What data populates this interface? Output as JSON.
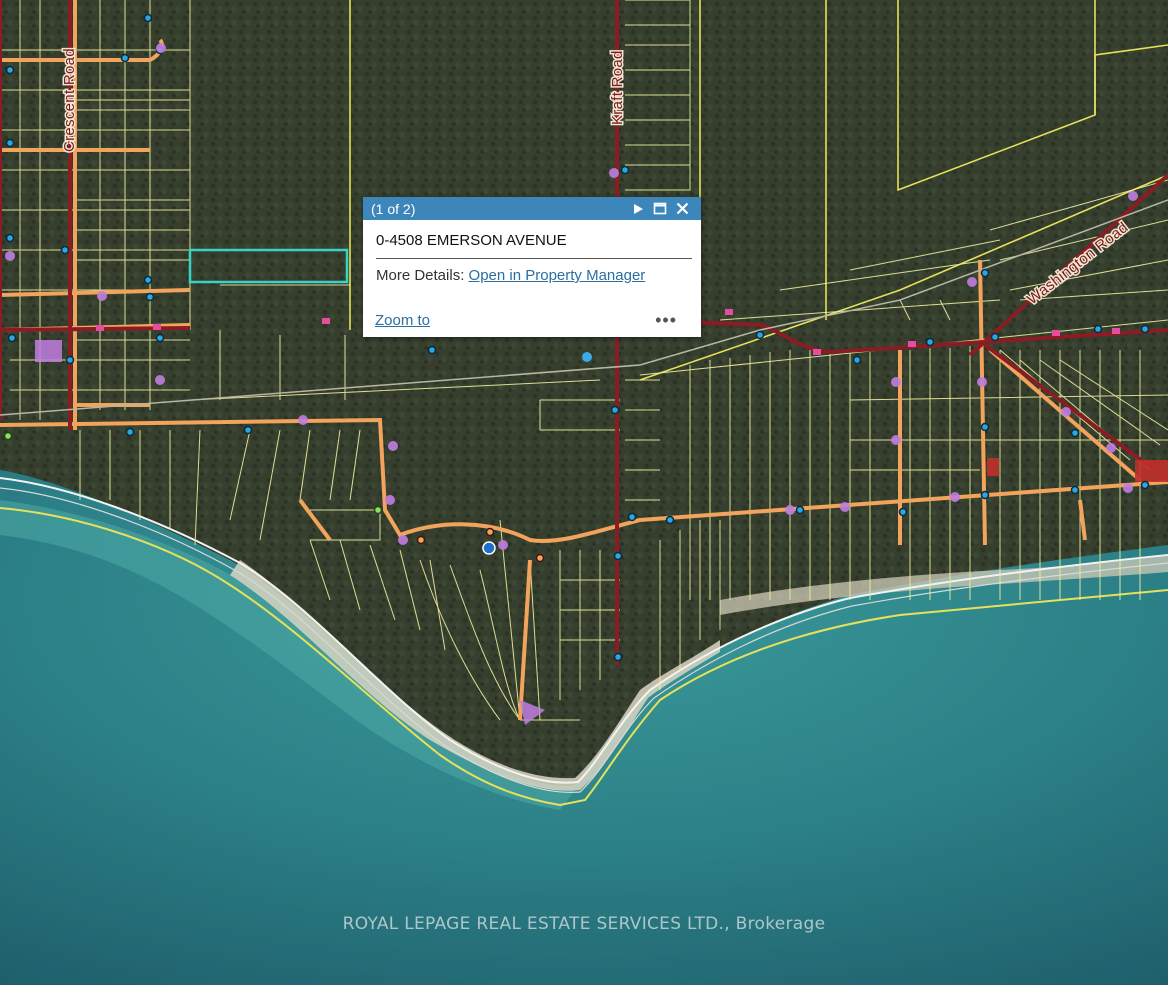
{
  "map": {
    "road_labels": {
      "crescent": "Crescent Road",
      "kraft": "Kraft Road",
      "washington": "Washington Road"
    },
    "colors": {
      "water": "#2d7f86",
      "land": "#34402c",
      "parcel_lines": "#f0f0a0",
      "roads_major": "#8a1c24",
      "roads_minor": "#f2a35c",
      "shoreline": "#e8e2cc",
      "boundary": "#e6e15a",
      "selected_parcel": "#39d2c8",
      "marker_blue": "#2aa6e0",
      "marker_pink": "#e64ca0",
      "marker_purple": "#c07ee0"
    }
  },
  "popup": {
    "counter": "(1 of 2)",
    "title": "0-4508 EMERSON AVENUE",
    "details_label": "More Details:",
    "details_link": "Open in Property Manager",
    "zoom_label": "Zoom to",
    "more_label": "•••"
  },
  "watermark": "ROYAL LEPAGE REAL ESTATE SERVICES LTD., Brokerage"
}
